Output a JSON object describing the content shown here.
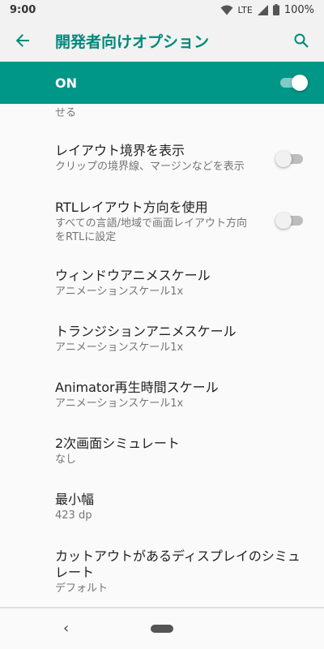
{
  "status": {
    "time": "9:00",
    "network": "LTE",
    "battery": "100%"
  },
  "app_bar": {
    "title": "開発者向けオプション"
  },
  "master_switch": {
    "label": "ON",
    "checked": true
  },
  "partial_summary": "せる",
  "items": [
    {
      "title": "レイアウト境界を表示",
      "summary": "クリップの境界線、マージンなどを表示",
      "switch": false
    },
    {
      "title": "RTLレイアウト方向を使用",
      "summary": "すべての言語/地域で画面レイアウト方向をRTLに設定",
      "switch": false
    },
    {
      "title": "ウィンドウアニメスケール",
      "summary": "アニメーションスケール1x"
    },
    {
      "title": "トランジションアニメスケール",
      "summary": "アニメーションスケール1x"
    },
    {
      "title": "Animator再生時間スケール",
      "summary": "アニメーションスケール1x"
    },
    {
      "title": "2次画面シミュレート",
      "summary": "なし"
    },
    {
      "title": "最小幅",
      "summary": "423 dp"
    },
    {
      "title": "カットアウトがあるディスプレイのシミュレート",
      "summary": "デフォルト"
    }
  ],
  "icons": {
    "back": "arrow-back-icon",
    "search": "search-icon",
    "wifi": "wifi-icon",
    "signal": "signal-icon",
    "battery": "battery-icon",
    "nav_back": "nav-back-icon",
    "nav_home": "home-pill-icon"
  },
  "colors": {
    "accent": "#009688",
    "title": "#00897b"
  }
}
